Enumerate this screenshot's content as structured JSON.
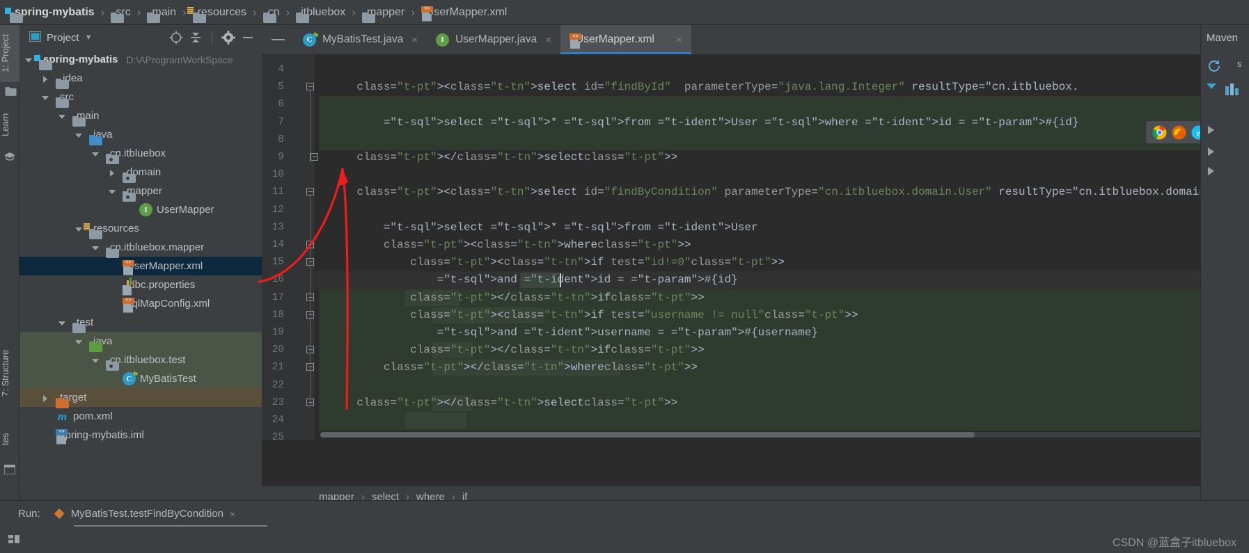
{
  "breadcrumb": {
    "items": [
      {
        "label": "spring-mybatis",
        "icon": "module-folder-icon",
        "bold": true
      },
      {
        "label": "src",
        "icon": "folder-icon",
        "bold": false
      },
      {
        "label": "main",
        "icon": "folder-icon",
        "bold": false
      },
      {
        "label": "resources",
        "icon": "resources-folder-icon",
        "bold": false
      },
      {
        "label": "cn",
        "icon": "folder-icon",
        "bold": false
      },
      {
        "label": "itbluebox",
        "icon": "folder-icon",
        "bold": false
      },
      {
        "label": "mapper",
        "icon": "folder-icon",
        "bold": false
      },
      {
        "label": "UserMapper.xml",
        "icon": "xml-file-icon",
        "bold": false
      }
    ],
    "separator": "›"
  },
  "left_tool_strips": [
    {
      "label": "1: Project",
      "selected": true
    },
    {
      "label": "Learn",
      "selected": false
    },
    {
      "label": "7: Structure",
      "selected": false
    },
    {
      "label": "tes",
      "selected": false
    }
  ],
  "project_panel": {
    "title": "Project",
    "dropdown_caret": "▼",
    "toolbar_icons": [
      "locate-icon",
      "collapse-all-icon",
      "settings-gear-icon",
      "hide-icon"
    ],
    "tree": [
      {
        "label": "spring-mybatis",
        "sub": "D:\\AProgramWorkSpace",
        "depth": 0,
        "twisty": "open",
        "icon": "module-folder-icon",
        "bold": true,
        "state": "normal"
      },
      {
        "label": ".idea",
        "sub": "",
        "depth": 1,
        "twisty": "closed",
        "icon": "folder-icon",
        "bold": false,
        "state": "normal"
      },
      {
        "label": "src",
        "sub": "",
        "depth": 1,
        "twisty": "open",
        "icon": "folder-icon",
        "bold": false,
        "state": "normal"
      },
      {
        "label": "main",
        "sub": "",
        "depth": 2,
        "twisty": "open",
        "icon": "folder-icon",
        "bold": false,
        "state": "normal"
      },
      {
        "label": "java",
        "sub": "",
        "depth": 3,
        "twisty": "open",
        "icon": "source-folder-blue-icon",
        "bold": false,
        "state": "normal"
      },
      {
        "label": "cn.itbluebox",
        "sub": "",
        "depth": 4,
        "twisty": "open",
        "icon": "package-icon",
        "bold": false,
        "state": "normal"
      },
      {
        "label": "domain",
        "sub": "",
        "depth": 5,
        "twisty": "closed",
        "icon": "package-icon",
        "bold": false,
        "state": "normal"
      },
      {
        "label": "mapper",
        "sub": "",
        "depth": 5,
        "twisty": "open",
        "icon": "package-icon",
        "bold": false,
        "state": "normal"
      },
      {
        "label": "UserMapper",
        "sub": "",
        "depth": 6,
        "twisty": "none",
        "icon": "interface-icon",
        "bold": false,
        "state": "normal"
      },
      {
        "label": "resources",
        "sub": "",
        "depth": 3,
        "twisty": "open",
        "icon": "resources-folder-icon",
        "bold": false,
        "state": "normal"
      },
      {
        "label": "cn.itbluebox.mapper",
        "sub": "",
        "depth": 4,
        "twisty": "open",
        "icon": "folder-icon",
        "bold": false,
        "state": "normal"
      },
      {
        "label": "UserMapper.xml",
        "sub": "",
        "depth": 5,
        "twisty": "none",
        "icon": "xml-file-icon",
        "bold": false,
        "state": "selected"
      },
      {
        "label": "jdbc.properties",
        "sub": "",
        "depth": 5,
        "twisty": "none",
        "icon": "properties-file-icon",
        "bold": false,
        "state": "normal"
      },
      {
        "label": "sqlMapConfig.xml",
        "sub": "",
        "depth": 5,
        "twisty": "none",
        "icon": "xml-file-icon",
        "bold": false,
        "state": "normal"
      },
      {
        "label": "test",
        "sub": "",
        "depth": 2,
        "twisty": "open",
        "icon": "folder-icon",
        "bold": false,
        "state": "normal"
      },
      {
        "label": "java",
        "sub": "",
        "depth": 3,
        "twisty": "open",
        "icon": "test-source-folder-green-icon",
        "bold": false,
        "state": "green"
      },
      {
        "label": "cn.itbluebox.test",
        "sub": "",
        "depth": 4,
        "twisty": "open",
        "icon": "package-icon",
        "bold": false,
        "state": "green"
      },
      {
        "label": "MyBatisTest",
        "sub": "",
        "depth": 5,
        "twisty": "none",
        "icon": "java-class-icon",
        "bold": false,
        "state": "green"
      },
      {
        "label": "target",
        "sub": "",
        "depth": 1,
        "twisty": "closed",
        "icon": "excluded-folder-orange-icon",
        "bold": false,
        "state": "brown"
      },
      {
        "label": "pom.xml",
        "sub": "",
        "depth": 1,
        "twisty": "none",
        "icon": "maven-pom-icon",
        "bold": false,
        "state": "normal"
      },
      {
        "label": "spring-mybatis.iml",
        "sub": "",
        "depth": 1,
        "twisty": "none",
        "icon": "module-file-icon",
        "bold": false,
        "state": "normal"
      }
    ]
  },
  "editor": {
    "tabs": [
      {
        "label": "MyBatisTest.java",
        "icon": "java-class-icon",
        "active": false,
        "close": "×"
      },
      {
        "label": "UserMapper.java",
        "icon": "interface-icon",
        "active": false,
        "close": "×"
      },
      {
        "label": "UserMapper.xml",
        "icon": "xml-file-icon",
        "active": true,
        "close": "×"
      }
    ],
    "minimize_button": "—",
    "inspection_ok": "✓",
    "line_numbers": [
      "4",
      "5",
      "6",
      "7",
      "8",
      "9",
      "10",
      "11",
      "12",
      "13",
      "14",
      "15",
      "16",
      "17",
      "18",
      "19",
      "20",
      "21",
      "22",
      "23",
      "24",
      "25"
    ],
    "code_lines": [
      {
        "n": "4",
        "text": ""
      },
      {
        "n": "5",
        "text": "    <select id=\"findById\"  parameterType=\"java.lang.Integer\" resultType=\"cn.itbluebox."
      },
      {
        "n": "6",
        "text": ""
      },
      {
        "n": "7",
        "text": "        select * from User where id = #{id}"
      },
      {
        "n": "8",
        "text": ""
      },
      {
        "n": "9",
        "text": "    </select>"
      },
      {
        "n": "10",
        "text": ""
      },
      {
        "n": "11",
        "text": "    <select id=\"findByCondition\" parameterType=\"cn.itbluebox.domain.User\" resultType=\"cn.itbluebox.domain.Use"
      },
      {
        "n": "12",
        "text": ""
      },
      {
        "n": "13",
        "text": "        select * from User"
      },
      {
        "n": "14",
        "text": "        <where>"
      },
      {
        "n": "15",
        "text": "            <if test=\"id!=0\">"
      },
      {
        "n": "16",
        "text": "                and id = #{id}"
      },
      {
        "n": "17",
        "text": "            </if>"
      },
      {
        "n": "18",
        "text": "            <if test=\"username != null\">"
      },
      {
        "n": "19",
        "text": "                and username = #{username}"
      },
      {
        "n": "20",
        "text": "            </if>"
      },
      {
        "n": "21",
        "text": "        </where>"
      },
      {
        "n": "22",
        "text": ""
      },
      {
        "n": "23",
        "text": "    </select>"
      },
      {
        "n": "24",
        "text": ""
      },
      {
        "n": "25",
        "text": ""
      }
    ],
    "breadcrumb_bottom": {
      "items": [
        "mapper",
        "select",
        "where",
        "if"
      ],
      "separator": "›"
    },
    "browser_chips": [
      "chrome-icon",
      "firefox-icon",
      "ie-icon",
      "opera-icon",
      "edge-legacy-icon",
      "edge-icon"
    ]
  },
  "right_panel": {
    "title": "Maven",
    "icons": [
      "refresh-icon",
      "maven-tool-icon",
      "collapse-icon"
    ],
    "run_arrows": [
      "run-arrow-icon",
      "run-arrow-icon",
      "run-arrow-icon"
    ]
  },
  "run_bar": {
    "label": "Run:",
    "tab_label": "MyBatisTest.testFindByCondition",
    "tab_icon": "run-config-icon",
    "close": "×"
  },
  "status_bar": {
    "watermark": "CSDN @蓝盒子itbluebox"
  },
  "colors": {
    "accent": "#2e7ec9",
    "selection": "#0d293e",
    "test_green": "#4a5548",
    "excluded_brown": "#5a4f3b",
    "annotation_red": "#ee1c1c",
    "editor_bg": "#2b2b2b",
    "panel_bg": "#3c3f41"
  }
}
